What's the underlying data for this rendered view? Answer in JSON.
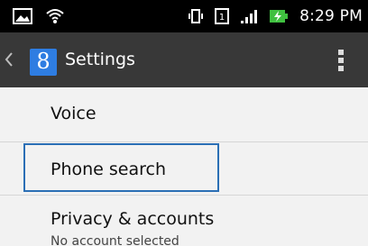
{
  "status_bar": {
    "time": "8:29 PM",
    "left_icons": [
      "image-notification-icon",
      "wifi-icon"
    ],
    "right_icons": [
      "vibrate-icon",
      "sim-icon",
      "signal-icon",
      "battery-charging-icon"
    ],
    "battery_color": "#40c040"
  },
  "action_bar": {
    "title": "Settings",
    "logo_letter": "8",
    "logo_color": "#2e7de2",
    "background": "#383838"
  },
  "list": {
    "items": [
      {
        "label": "Voice"
      },
      {
        "label": "Phone search"
      },
      {
        "label": "Privacy & accounts",
        "sublabel": "No account selected"
      }
    ],
    "focus_color": "#2b6fb5"
  }
}
